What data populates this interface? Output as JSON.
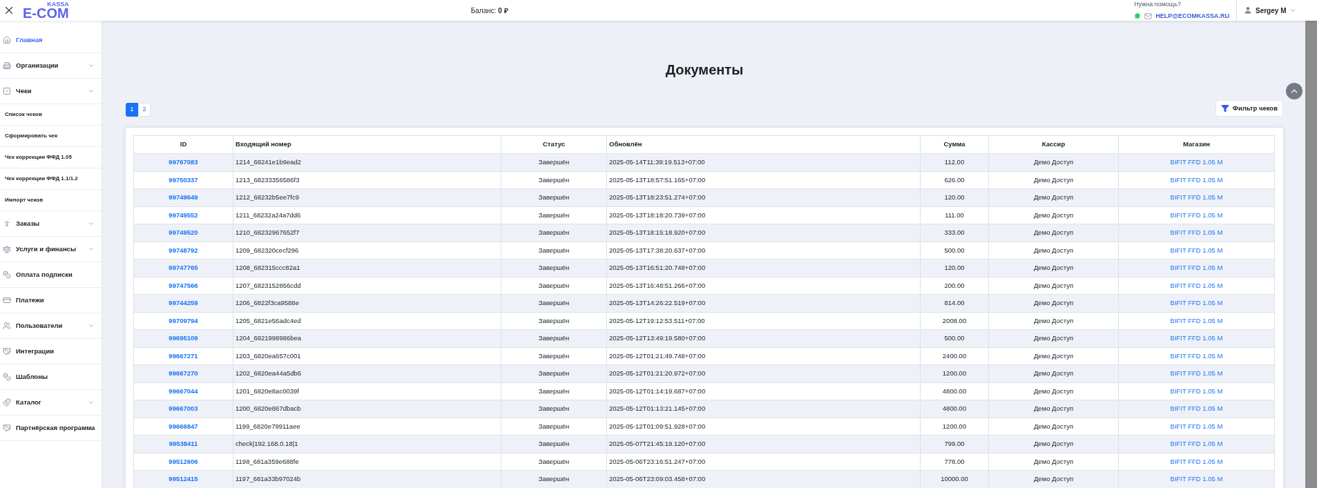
{
  "header": {
    "logo_small": "KASSA",
    "logo": "E-COM",
    "balance": "Баланс: **0 ₽**",
    "help_title": "Нужна помощь?",
    "help_email": "HELP@ECOMKASSA.RU",
    "user": "Sergey M"
  },
  "sidebar": {
    "items": [
      {
        "label": "Главная",
        "selected": true,
        "kind": "link"
      },
      {
        "label": "Организации",
        "selected": false,
        "kind": "group"
      },
      {
        "label": "Чеки",
        "selected": false,
        "kind": "group",
        "children": [
          {
            "label": "Список чеков"
          },
          {
            "label": "Сформировать чек"
          },
          {
            "label": "Чек коррекции ФФД 1.05"
          },
          {
            "label": "Чек коррекции ФФД 1.1/1.2"
          },
          {
            "label": "Импорт чеков"
          }
        ]
      },
      {
        "label": "Заказы",
        "selected": false,
        "kind": "group"
      },
      {
        "label": "Услуги и финансы",
        "selected": false,
        "kind": "group"
      },
      {
        "label": "Оплата подписки",
        "selected": false,
        "kind": "link"
      },
      {
        "label": "Платежи",
        "selected": false,
        "kind": "link"
      },
      {
        "label": "Пользователи",
        "selected": false,
        "kind": "group"
      },
      {
        "label": "Интеграции",
        "selected": false,
        "kind": "link"
      },
      {
        "label": "Шаблоны",
        "selected": false,
        "kind": "link"
      },
      {
        "label": "Каталог",
        "selected": false,
        "kind": "group"
      },
      {
        "label": "Партнёрская программа",
        "selected": false,
        "kind": "link"
      }
    ]
  },
  "page": {
    "title": "Документы",
    "pages": [
      {
        "label": "1",
        "selected": true
      },
      {
        "label": "2",
        "selected": false
      }
    ],
    "filter_button": "Фильтр чеков"
  },
  "table": {
    "columns": [
      "ID",
      "Входящий номер",
      "Статус",
      "Обновлён",
      "Сумма",
      "Кассир",
      "Магазин"
    ],
    "rows": [
      [
        "99767083",
        "1214_68241e1b9ead2",
        "Завершён",
        "2025-05-14T11:39:19.513+07:00",
        "112.00",
        "Демо Доступ",
        "BIFIT FFD 1.05 M"
      ],
      [
        "99750337",
        "1213_68233356586f3",
        "Завершён",
        "2025-05-13T18:57:51.165+07:00",
        "626.00",
        "Демо Доступ",
        "BIFIT FFD 1.05 M"
      ],
      [
        "99749649",
        "1212_68232b5ee7fc9",
        "Завершён",
        "2025-05-13T18:23:51.274+07:00",
        "120.00",
        "Демо Доступ",
        "BIFIT FFD 1.05 M"
      ],
      [
        "99749552",
        "1211_68232a24a7dd6",
        "Завершён",
        "2025-05-13T18:18:20.739+07:00",
        "111.00",
        "Демо Доступ",
        "BIFIT FFD 1.05 M"
      ],
      [
        "99749520",
        "1210_68232967652f7",
        "Завершён",
        "2025-05-13T18:15:18.920+07:00",
        "333.00",
        "Демо Доступ",
        "BIFIT FFD 1.05 M"
      ],
      [
        "99748792",
        "1209_682320cecf296",
        "Завершён",
        "2025-05-13T17:38:20.637+07:00",
        "500.00",
        "Демо Доступ",
        "BIFIT FFD 1.05 M"
      ],
      [
        "99747765",
        "1208_682315ccc82a1",
        "Завершён",
        "2025-05-13T16:51:20.748+07:00",
        "120.00",
        "Демо Доступ",
        "BIFIT FFD 1.05 M"
      ],
      [
        "99747566",
        "1207_6823152856cdd",
        "Завершён",
        "2025-05-13T16:48:51.266+07:00",
        "200.00",
        "Демо Доступ",
        "BIFIT FFD 1.05 M"
      ],
      [
        "99744259",
        "1206_6822f3ca9588e",
        "Завершён",
        "2025-05-13T14:26:22.519+07:00",
        "814.00",
        "Демо Доступ",
        "BIFIT FFD 1.05 M"
      ],
      [
        "99709794",
        "1205_6821e56adc4ed",
        "Завершён",
        "2025-05-12T19:12:53.511+07:00",
        "2008.00",
        "Демо Доступ",
        "BIFIT FFD 1.05 M"
      ],
      [
        "99695109",
        "1204_6821998986bea",
        "Завершён",
        "2025-05-12T13:49:19.580+07:00",
        "500.00",
        "Демо Доступ",
        "BIFIT FFD 1.05 M"
      ],
      [
        "99667271",
        "1203_6820ea657c001",
        "Завершён",
        "2025-05-12T01:21:49.748+07:00",
        "2400.00",
        "Демо Доступ",
        "BIFIT FFD 1.05 M"
      ],
      [
        "99667270",
        "1202_6820ea44a5db6",
        "Завершён",
        "2025-05-12T01:21:20.972+07:00",
        "1200.00",
        "Демо Доступ",
        "BIFIT FFD 1.05 M"
      ],
      [
        "99667044",
        "1201_6820e8ac0039f",
        "Завершён",
        "2025-05-12T01:14:19.687+07:00",
        "4800.00",
        "Демо Доступ",
        "BIFIT FFD 1.05 M"
      ],
      [
        "99667003",
        "1200_6820e867dbacb",
        "Завершён",
        "2025-05-12T01:13:21.145+07:00",
        "4800.00",
        "Демо Доступ",
        "BIFIT FFD 1.05 M"
      ],
      [
        "99666847",
        "1199_6820e79911aee",
        "Завершён",
        "2025-05-12T01:09:51.928+07:00",
        "1200.00",
        "Демо Доступ",
        "BIFIT FFD 1.05 M"
      ],
      [
        "99538411",
        "check|192.168.0.18|1",
        "Завершён",
        "2025-05-07T21:45:19.120+07:00",
        "799.00",
        "Демо Доступ",
        "BIFIT FFD 1.05 M"
      ],
      [
        "99512606",
        "1198_681a359e688fe",
        "Завершён",
        "2025-05-06T23:16:51.247+07:00",
        "778.00",
        "Демо Доступ",
        "BIFIT FFD 1.05 M"
      ],
      [
        "99512415",
        "1197_681a33b97024b",
        "Завершён",
        "2025-05-06T23:09:03.458+07:00",
        "10000.00",
        "Демо Доступ",
        "BIFIT FFD 1.05 M"
      ]
    ]
  }
}
